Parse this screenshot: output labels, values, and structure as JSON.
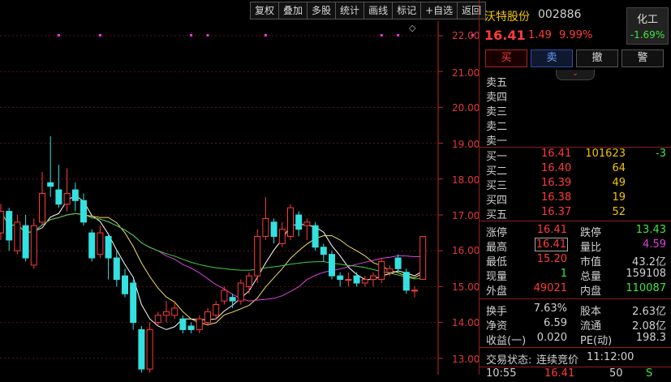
{
  "toolbar": {
    "buttons": [
      "复权",
      "叠加",
      "多股",
      "统计",
      "画线",
      "标记",
      "+自选",
      "返回"
    ]
  },
  "chart": {
    "marker": "◇",
    "y_ticks": [
      "22.00",
      "21.00",
      "20.00",
      "19.00",
      "18.00",
      "17.00",
      "16.00",
      "15.00",
      "14.00",
      "13.00"
    ],
    "y_values": [
      22,
      21,
      20,
      19,
      18,
      17,
      16,
      15,
      14,
      13
    ],
    "magenta_dots": [
      7,
      12,
      23,
      25,
      32,
      46,
      48,
      57
    ],
    "candles": [
      {
        "o": 16.5,
        "c": 17.1,
        "h": 17.3,
        "l": 16.3
      },
      {
        "o": 17.1,
        "c": 16.3,
        "h": 17.2,
        "l": 16.0
      },
      {
        "o": 16.0,
        "c": 16.8,
        "h": 17.0,
        "l": 15.9
      },
      {
        "o": 16.7,
        "c": 15.8,
        "h": 17.0,
        "l": 15.7
      },
      {
        "o": 15.6,
        "c": 16.7,
        "h": 16.9,
        "l": 15.5
      },
      {
        "o": 16.8,
        "c": 17.6,
        "h": 18.2,
        "l": 16.7
      },
      {
        "o": 17.9,
        "c": 17.8,
        "h": 19.2,
        "l": 17.5
      },
      {
        "o": 17.7,
        "c": 17.3,
        "h": 18.4,
        "l": 17.2
      },
      {
        "o": 17.3,
        "c": 17.6,
        "h": 18.3,
        "l": 17.1
      },
      {
        "o": 17.7,
        "c": 17.4,
        "h": 17.9,
        "l": 17.1
      },
      {
        "o": 17.4,
        "c": 16.8,
        "h": 17.6,
        "l": 16.7
      },
      {
        "o": 16.5,
        "c": 15.8,
        "h": 16.6,
        "l": 15.7
      },
      {
        "o": 15.9,
        "c": 16.5,
        "h": 16.7,
        "l": 15.8
      },
      {
        "o": 16.4,
        "c": 15.8,
        "h": 16.5,
        "l": 15.2
      },
      {
        "o": 15.8,
        "c": 15.2,
        "h": 16.0,
        "l": 15.0
      },
      {
        "o": 15.3,
        "c": 14.8,
        "h": 15.5,
        "l": 14.7
      },
      {
        "o": 15.1,
        "c": 14.0,
        "h": 15.2,
        "l": 13.8
      },
      {
        "o": 13.8,
        "c": 12.7,
        "h": 13.9,
        "l": 12.6
      },
      {
        "o": 12.7,
        "c": 13.8,
        "h": 14.0,
        "l": 12.6
      },
      {
        "o": 14.0,
        "c": 14.2,
        "h": 14.3,
        "l": 13.9
      },
      {
        "o": 14.2,
        "c": 14.3,
        "h": 14.6,
        "l": 14.0
      },
      {
        "o": 14.2,
        "c": 14.4,
        "h": 14.6,
        "l": 14.1
      },
      {
        "o": 14.1,
        "c": 13.8,
        "h": 14.2,
        "l": 13.7
      },
      {
        "o": 13.9,
        "c": 13.8,
        "h": 14.0,
        "l": 13.7
      },
      {
        "o": 13.8,
        "c": 14.1,
        "h": 14.2,
        "l": 13.7
      },
      {
        "o": 14.0,
        "c": 14.3,
        "h": 14.4,
        "l": 13.9
      },
      {
        "o": 14.2,
        "c": 14.5,
        "h": 14.6,
        "l": 14.1
      },
      {
        "o": 14.6,
        "c": 14.9,
        "h": 15.0,
        "l": 14.5
      },
      {
        "o": 14.7,
        "c": 14.6,
        "h": 14.8,
        "l": 14.4
      },
      {
        "o": 14.6,
        "c": 15.1,
        "h": 15.2,
        "l": 14.5
      },
      {
        "o": 15.0,
        "c": 15.3,
        "h": 15.4,
        "l": 14.8
      },
      {
        "o": 15.3,
        "c": 16.4,
        "h": 16.6,
        "l": 15.1
      },
      {
        "o": 16.4,
        "c": 16.9,
        "h": 17.5,
        "l": 16.3
      },
      {
        "o": 16.8,
        "c": 16.4,
        "h": 16.9,
        "l": 16.2
      },
      {
        "o": 16.2,
        "c": 16.6,
        "h": 16.8,
        "l": 16.1
      },
      {
        "o": 16.4,
        "c": 17.2,
        "h": 17.3,
        "l": 16.3
      },
      {
        "o": 17.0,
        "c": 16.6,
        "h": 17.1,
        "l": 16.4
      },
      {
        "o": 16.7,
        "c": 16.8,
        "h": 16.9,
        "l": 16.3
      },
      {
        "o": 16.7,
        "c": 16.1,
        "h": 16.8,
        "l": 16.0
      },
      {
        "o": 16.1,
        "c": 15.9,
        "h": 16.2,
        "l": 15.7
      },
      {
        "o": 15.9,
        "c": 15.3,
        "h": 16.0,
        "l": 15.2
      },
      {
        "o": 15.3,
        "c": 15.2,
        "h": 15.4,
        "l": 15.0
      },
      {
        "o": 15.2,
        "c": 15.2,
        "h": 15.4,
        "l": 15.0
      },
      {
        "o": 15.3,
        "c": 15.1,
        "h": 15.4,
        "l": 15.0
      },
      {
        "o": 15.1,
        "c": 15.2,
        "h": 15.3,
        "l": 15.0
      },
      {
        "o": 15.2,
        "c": 15.3,
        "h": 15.4,
        "l": 15.0
      },
      {
        "o": 15.2,
        "c": 15.7,
        "h": 15.8,
        "l": 15.1
      },
      {
        "o": 15.4,
        "c": 15.5,
        "h": 15.6,
        "l": 15.3
      },
      {
        "o": 15.8,
        "c": 15.5,
        "h": 15.9,
        "l": 15.4
      },
      {
        "o": 15.4,
        "c": 14.9,
        "h": 15.5,
        "l": 14.8
      },
      {
        "o": 14.9,
        "c": 14.9,
        "h": 15.0,
        "l": 14.7
      },
      {
        "o": 15.2,
        "c": 16.4,
        "h": 16.4,
        "l": 15.2
      }
    ],
    "ma_colors": {
      "ma5": "#ffffff",
      "ma10": "#f0e060",
      "ma20": "#e040e0",
      "ma60": "#40d040"
    }
  },
  "stock": {
    "name": "沃特股份",
    "code": "002886",
    "price": "16.41",
    "change": "1.49",
    "pct": "9.99%",
    "sector": "化工",
    "sector_pct": "-1.69%"
  },
  "actions": [
    "买",
    "卖",
    "撤",
    "警"
  ],
  "sell_levels": [
    "卖五",
    "卖四",
    "卖三",
    "卖二",
    "卖一"
  ],
  "buy_levels": [
    {
      "label": "买一",
      "price": "16.41",
      "vol": "101623",
      "chg": "-3"
    },
    {
      "label": "买二",
      "price": "16.40",
      "vol": "64",
      "chg": ""
    },
    {
      "label": "买三",
      "price": "16.39",
      "vol": "49",
      "chg": ""
    },
    {
      "label": "买四",
      "price": "16.38",
      "vol": "19",
      "chg": ""
    },
    {
      "label": "买五",
      "price": "16.37",
      "vol": "52",
      "chg": ""
    }
  ],
  "stats": [
    {
      "l1": "涨停",
      "v1": "16.41",
      "c1": "r",
      "l2": "跌停",
      "v2": "13.43",
      "c2": "g"
    },
    {
      "l1": "最高",
      "v1": "16.41",
      "c1": "r",
      "l2": "量比",
      "v2": "4.59",
      "c2": "m"
    },
    {
      "l1": "最低",
      "v1": "15.20",
      "c1": "r",
      "l2": "市值",
      "v2": "43.2亿",
      "c2": "w"
    },
    {
      "l1": "现量",
      "v1": "1",
      "c1": "g",
      "l2": "总量",
      "v2": "159108",
      "c2": "w"
    },
    {
      "l1": "外盘",
      "v1": "49021",
      "c1": "r",
      "l2": "内盘",
      "v2": "110087",
      "c2": "g"
    }
  ],
  "stats2": [
    {
      "l1": "换手",
      "v1": "7.63%",
      "l2": "股本",
      "v2": "2.63亿"
    },
    {
      "l1": "净资",
      "v1": "6.59",
      "l2": "流通",
      "v2": "2.08亿"
    },
    {
      "l1": "收益(一)",
      "v1": "0.020",
      "l2": "PE(动)",
      "v2": "198.3"
    }
  ],
  "status": {
    "label": "交易状态:",
    "value": "连续竞价",
    "time": "11:12:00"
  },
  "tick": {
    "time": "10:55",
    "price": "16.41",
    "vol": "50",
    "dir": "S"
  }
}
